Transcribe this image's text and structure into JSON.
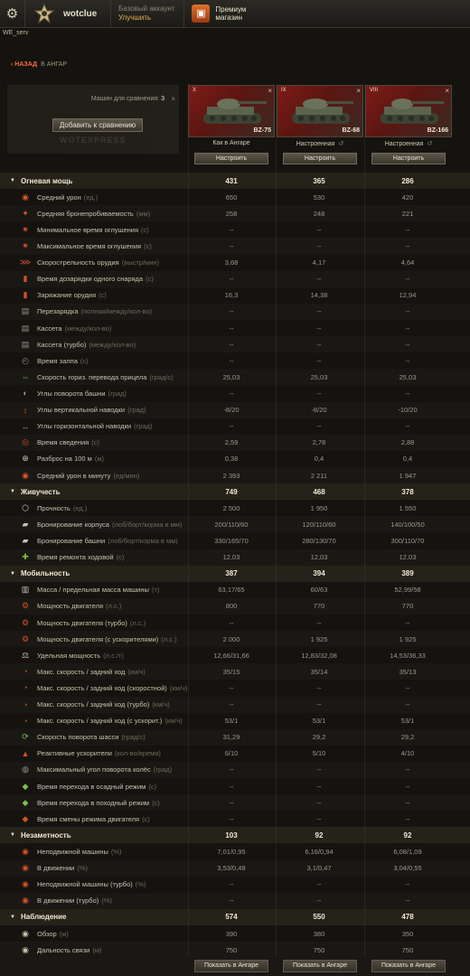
{
  "topbar": {
    "username": "wotclue",
    "account_type": "Базовый аккаунт",
    "upgrade": "Улучшить",
    "shop_line1": "Премиум",
    "shop_line2": "магазин"
  },
  "server": "WE_serv",
  "nav": {
    "back": "НАЗАД",
    "location": "В АНГАР"
  },
  "compare": {
    "label": "Машин для сравнения:",
    "count": "3",
    "close": "×",
    "add_button": "Добавить к сравнению",
    "watermark": "WOTEXPRESS"
  },
  "tanks": [
    {
      "tier": "X",
      "name": "BZ-75",
      "state": "Как в Ангаре",
      "configure": "Настроить",
      "close": "×"
    },
    {
      "tier": "IX",
      "name": "BZ-68",
      "state": "Настроенная",
      "configure": "Настроить",
      "close": "×"
    },
    {
      "tier": "VIII",
      "name": "BZ-166",
      "state": "Настроенная",
      "configure": "Настроить",
      "close": "×"
    }
  ],
  "rows": [
    {
      "t": "s",
      "n": "Огневая мощь",
      "v": [
        "431",
        "365",
        "286"
      ],
      "h": [
        0,
        0,
        0
      ]
    },
    {
      "n": "Средний урон",
      "u": "(ед.)",
      "v": [
        "650",
        "530",
        "420"
      ],
      "h": [
        1,
        0,
        0
      ],
      "i": "◉",
      "c": "#e0542b"
    },
    {
      "n": "Средняя бронепробиваемость",
      "u": "(мм)",
      "v": [
        "258",
        "248",
        "221"
      ],
      "h": [
        1,
        0,
        0
      ],
      "i": "✦",
      "c": "#e0542b"
    },
    {
      "n": "Минимальное время оглушения",
      "u": "(с)",
      "v": [
        "--",
        "--",
        "--"
      ],
      "h": [
        0,
        0,
        0
      ],
      "i": "✷",
      "c": "#d4502a"
    },
    {
      "n": "Максимальное время оглушения",
      "u": "(с)",
      "v": [
        "--",
        "--",
        "--"
      ],
      "h": [
        0,
        0,
        0
      ],
      "i": "✷",
      "c": "#d4502a"
    },
    {
      "n": "Скорострельность орудия",
      "u": "(выстр/мин)",
      "v": [
        "3,68",
        "4,17",
        "4,64"
      ],
      "h": [
        0,
        0,
        1
      ],
      "i": "⋙",
      "c": "#d4502a"
    },
    {
      "n": "Время дозарядки одного снаряда",
      "u": "(с)",
      "v": [
        "--",
        "--",
        "--"
      ],
      "h": [
        0,
        0,
        0
      ],
      "i": "▮",
      "c": "#d4502a"
    },
    {
      "n": "Заряжание орудия",
      "u": "(с)",
      "v": [
        "16,3",
        "14,38",
        "12,94"
      ],
      "h": [
        0,
        0,
        1
      ],
      "i": "▮",
      "c": "#d4502a"
    },
    {
      "n": "Перезарядка",
      "u": "(полная/между/кол-во)",
      "v": [
        "--",
        "--",
        "--"
      ],
      "h": [
        0,
        0,
        0
      ],
      "i": "▤",
      "c": "#9a9482"
    },
    {
      "n": "Кассета",
      "u": "(между/кол-во)",
      "v": [
        "--",
        "--",
        "--"
      ],
      "h": [
        0,
        0,
        0
      ],
      "i": "▤",
      "c": "#9a9482"
    },
    {
      "n": "Кассета (турбо)",
      "u": "(между/кол-во)",
      "v": [
        "--",
        "--",
        "--"
      ],
      "h": [
        0,
        0,
        0
      ],
      "i": "▤",
      "c": "#9a9482"
    },
    {
      "n": "Время залпа",
      "u": "(с)",
      "v": [
        "--",
        "--",
        "--"
      ],
      "h": [
        0,
        0,
        0
      ],
      "i": "◴",
      "c": "#9a9482"
    },
    {
      "n": "Скорость гориз. перевода прицела",
      "u": "(град/с)",
      "v": [
        "25,03",
        "25,03",
        "25,03"
      ],
      "h": [
        1,
        1,
        1
      ],
      "i": "⇔",
      "c": "#7dbf4a"
    },
    {
      "n": "Углы поворота башни",
      "u": "(град)",
      "v": [
        "--",
        "--",
        "--"
      ],
      "h": [
        0,
        0,
        0
      ],
      "i": "◐",
      "c": "#9a9482"
    },
    {
      "n": "Углы вертикальной наводки",
      "u": "(град)",
      "v": [
        "-8/20",
        "-8/20",
        "-10/20"
      ],
      "h": [
        0,
        0,
        1
      ],
      "i": "↕",
      "c": "#d4502a"
    },
    {
      "n": "Углы горизонтальной наводки",
      "u": "(град)",
      "v": [
        "--",
        "--",
        "--"
      ],
      "h": [
        0,
        0,
        0
      ],
      "i": "↔",
      "c": "#9a9482"
    },
    {
      "n": "Время сведения",
      "u": "(с)",
      "v": [
        "2,59",
        "2,78",
        "2,88"
      ],
      "h": [
        1,
        0,
        0
      ],
      "i": "◎",
      "c": "#d4502a"
    },
    {
      "n": "Разброс на 100 м",
      "u": "(м)",
      "v": [
        "0,38",
        "0,4",
        "0,4"
      ],
      "h": [
        1,
        0,
        0
      ],
      "i": "⊕",
      "c": "#c9c2ae"
    },
    {
      "n": "Средний урон в минуту",
      "u": "(ед/мин)",
      "v": [
        "2 393",
        "2 211",
        "1 947"
      ],
      "h": [
        1,
        0,
        0
      ],
      "i": "◉",
      "c": "#e0542b"
    },
    {
      "t": "s",
      "n": "Живучесть",
      "v": [
        "749",
        "468",
        "378"
      ],
      "h": [
        0,
        0,
        0
      ]
    },
    {
      "n": "Прочность",
      "u": "(ед.)",
      "v": [
        "2 500",
        "1 950",
        "1 550"
      ],
      "h": [
        1,
        0,
        0
      ],
      "i": "⬡",
      "c": "#c9c2ae"
    },
    {
      "n": "Бронирование корпуса",
      "u": "(лоб/борт/корма в мм)",
      "v": [
        "200/110/60",
        "120/110/60",
        "140/100/50"
      ],
      "h": [
        1,
        0,
        0
      ],
      "i": "▰",
      "c": "#c9c2ae"
    },
    {
      "n": "Бронирование башни",
      "u": "(лоб/борт/корма в мм)",
      "v": [
        "330/165/70",
        "280/130/70",
        "300/110/70"
      ],
      "h": [
        1,
        0,
        0
      ],
      "i": "▰",
      "c": "#c9c2ae"
    },
    {
      "n": "Время ремонта ходовой",
      "u": "(с)",
      "v": [
        "12,03",
        "12,03",
        "12,03"
      ],
      "h": [
        1,
        1,
        1
      ],
      "i": "✚",
      "c": "#7dbf4a"
    },
    {
      "t": "s",
      "n": "Мобильность",
      "v": [
        "387",
        "394",
        "389"
      ],
      "h": [
        0,
        0,
        0
      ]
    },
    {
      "n": "Масса / предельная масса машины",
      "u": "(т)",
      "v": [
        "63,17/65",
        "60/63",
        "52,99/58"
      ],
      "h": [
        0,
        0,
        1
      ],
      "i": "▥",
      "c": "#c9c2ae"
    },
    {
      "n": "Мощность двигателя",
      "u": "(л.с.)",
      "v": [
        "800",
        "770",
        "770"
      ],
      "h": [
        1,
        0,
        0
      ],
      "i": "⚙",
      "c": "#d4502a"
    },
    {
      "n": "Мощность двигателя (турбо)",
      "u": "(л.с.)",
      "v": [
        "--",
        "--",
        "--"
      ],
      "h": [
        0,
        0,
        0
      ],
      "i": "⚙",
      "c": "#d4502a"
    },
    {
      "n": "Мощность двигателя (с ускорителями)",
      "u": "(л.с.)",
      "v": [
        "2 000",
        "1 925",
        "1 925"
      ],
      "h": [
        1,
        0,
        0
      ],
      "i": "⚙",
      "c": "#d4502a"
    },
    {
      "n": "Удельная мощность",
      "u": "(л.с./т)",
      "v": [
        "12,66/31,66",
        "12,83/32,08",
        "14,53/36,33"
      ],
      "h": [
        0,
        0,
        1
      ],
      "i": "⚖",
      "c": "#c9c2ae"
    },
    {
      "n": "Макс. скорость / задний ход",
      "u": "(км/ч)",
      "v": [
        "35/15",
        "35/14",
        "35/13"
      ],
      "h": [
        1,
        1,
        1
      ],
      "i": "◔",
      "c": "#d4502a"
    },
    {
      "n": "Макс. скорость / задний ход (скоростной)",
      "u": "(км/ч)",
      "v": [
        "--",
        "--",
        "--"
      ],
      "h": [
        0,
        0,
        0
      ],
      "i": "◔",
      "c": "#d4502a"
    },
    {
      "n": "Макс. скорость / задний ход (турбо)",
      "u": "(км/ч)",
      "v": [
        "--",
        "--",
        "--"
      ],
      "h": [
        0,
        0,
        0
      ],
      "i": "◔",
      "c": "#d4502a"
    },
    {
      "n": "Макс. скорость / задний ход (с ускорит.)",
      "u": "(км/ч)",
      "v": [
        "53/1",
        "53/1",
        "53/1"
      ],
      "h": [
        1,
        1,
        1
      ],
      "i": "◔",
      "c": "#d4502a"
    },
    {
      "n": "Скорость поворота шасси",
      "u": "(град/с)",
      "v": [
        "31,29",
        "29,2",
        "29,2"
      ],
      "h": [
        1,
        0,
        0
      ],
      "i": "⟳",
      "c": "#7dbf4a"
    },
    {
      "n": "Реактивные ускорители",
      "u": "(кол-во/время)",
      "v": [
        "6/10",
        "5/10",
        "4/10"
      ],
      "h": [
        1,
        1,
        1
      ],
      "i": "▲",
      "c": "#d4502a"
    },
    {
      "n": "Максимальный угол поворота колёс",
      "u": "(град)",
      "v": [
        "--",
        "--",
        "--"
      ],
      "h": [
        0,
        0,
        0
      ],
      "i": "◍",
      "c": "#9a9482"
    },
    {
      "n": "Время перехода в осадный режим",
      "u": "(с)",
      "v": [
        "--",
        "--",
        "--"
      ],
      "h": [
        0,
        0,
        0
      ],
      "i": "◆",
      "c": "#7dbf4a"
    },
    {
      "n": "Время перехода в походный режим",
      "u": "(с)",
      "v": [
        "--",
        "--",
        "--"
      ],
      "h": [
        0,
        0,
        0
      ],
      "i": "◆",
      "c": "#7dbf4a"
    },
    {
      "n": "Время смены режима двигателя",
      "u": "(с)",
      "v": [
        "--",
        "--",
        "--"
      ],
      "h": [
        0,
        0,
        0
      ],
      "i": "◆",
      "c": "#d4502a"
    },
    {
      "t": "s",
      "n": "Незаметность",
      "v": [
        "103",
        "92",
        "92"
      ],
      "h": [
        0,
        0,
        0
      ]
    },
    {
      "n": "Неподвижной машины",
      "u": "(%)",
      "v": [
        "7,01/0,95",
        "6,16/0,94",
        "6,08/1,09"
      ],
      "h": [
        1,
        0,
        1
      ],
      "i": "◉",
      "c": "#d4502a"
    },
    {
      "n": "В движении",
      "u": "(%)",
      "v": [
        "3,53/0,48",
        "3,1/0,47",
        "3,04/0,55"
      ],
      "h": [
        1,
        0,
        1
      ],
      "i": "◉",
      "c": "#d4502a"
    },
    {
      "n": "Неподвижной машины (турбо)",
      "u": "(%)",
      "v": [
        "--",
        "--",
        "--"
      ],
      "h": [
        0,
        0,
        0
      ],
      "i": "◉",
      "c": "#d4502a"
    },
    {
      "n": "В движении (турбо)",
      "u": "(%)",
      "v": [
        "--",
        "--",
        "--"
      ],
      "h": [
        0,
        0,
        0
      ],
      "i": "◉",
      "c": "#d4502a"
    },
    {
      "t": "s",
      "n": "Наблюдение",
      "v": [
        "574",
        "550",
        "478"
      ],
      "h": [
        0,
        0,
        0
      ]
    },
    {
      "n": "Обзор",
      "u": "(м)",
      "v": [
        "390",
        "380",
        "350"
      ],
      "h": [
        1,
        0,
        0
      ],
      "i": "◉",
      "c": "#c9c2ae"
    },
    {
      "n": "Дальность связи",
      "u": "(м)",
      "v": [
        "750",
        "750",
        "750"
      ],
      "h": [
        1,
        1,
        1
      ],
      "i": "◉",
      "c": "#c9c2ae"
    }
  ],
  "bottom": {
    "show_in_hangar": "Показать в Ангаре"
  },
  "colors": {
    "accent_green": "#8fd35a",
    "accent_orange": "#ff6a3a",
    "background": "#15130f"
  }
}
